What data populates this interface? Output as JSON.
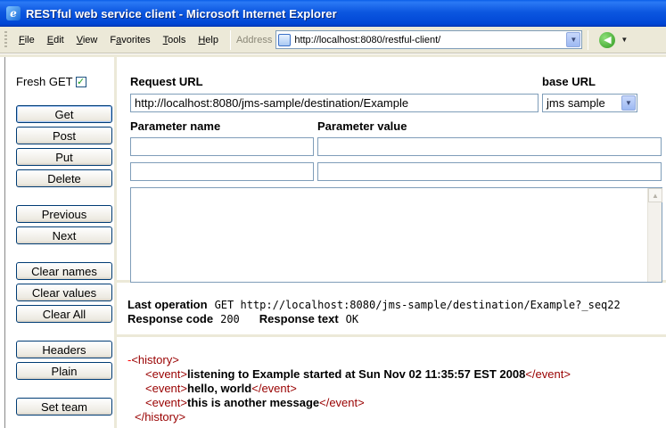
{
  "window": {
    "title": "RESTful web service client - Microsoft Internet Explorer"
  },
  "menu": {
    "items": [
      {
        "label": "File",
        "accel": "F",
        "rest": "ile"
      },
      {
        "label": "Edit",
        "accel": "E",
        "rest": "dit"
      },
      {
        "label": "View",
        "accel": "V",
        "rest": "iew"
      },
      {
        "label": "Favorites",
        "accel": "a",
        "pre": "F",
        "rest": "vorites"
      },
      {
        "label": "Tools",
        "accel": "T",
        "rest": "ools"
      },
      {
        "label": "Help",
        "accel": "H",
        "rest": "elp"
      }
    ]
  },
  "address": {
    "label": "Address",
    "url": "http://localhost:8080/restful-client/"
  },
  "sidebar": {
    "fresh_get_label": "Fresh GET",
    "fresh_get_checked": true,
    "buttons": {
      "get": "Get",
      "post": "Post",
      "put": "Put",
      "delete": "Delete",
      "previous": "Previous",
      "next": "Next",
      "clear_names": "Clear names",
      "clear_values": "Clear values",
      "clear_all": "Clear All",
      "headers": "Headers",
      "plain": "Plain",
      "set_team": "Set team"
    }
  },
  "request": {
    "url_label": "Request URL",
    "url_value": "http://localhost:8080/jms-sample/destination/Example",
    "base_url_label": "base URL",
    "base_url_value": "jms sample",
    "param_name_label": "Parameter name",
    "param_value_label": "Parameter value",
    "params": [
      {
        "name": "",
        "value": ""
      },
      {
        "name": "",
        "value": ""
      }
    ],
    "body": ""
  },
  "status": {
    "last_operation_label": "Last operation",
    "last_operation_value": "GET http://localhost:8080/jms-sample/destination/Example?_seq22",
    "response_code_label": "Response code",
    "response_code_value": "200",
    "response_text_label": "Response text",
    "response_text_value": "OK"
  },
  "response": {
    "minus": "-",
    "root_open": "<history>",
    "root_close": "</history>",
    "event_open": "<event>",
    "event_close": "</event>",
    "events": [
      "listening to Example started at Sun Nov 02 11:35:57 EST 2008",
      "hello, world",
      "this is another message"
    ]
  },
  "colors": {
    "titlebar": "#0046d5",
    "xml_tag": "#990000",
    "button_border": "#003c74"
  }
}
